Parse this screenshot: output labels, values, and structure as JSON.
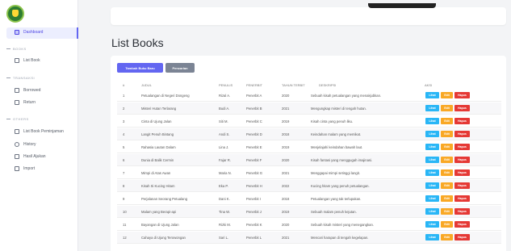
{
  "sidebar": {
    "dashboard": "Dashboard",
    "sections": [
      {
        "label": "BOOKS",
        "items": [
          "List Book"
        ]
      },
      {
        "label": "TRANSAKSI",
        "items": [
          "Borrowed",
          "Return"
        ]
      },
      {
        "label": "OTHERS",
        "items": [
          "List Book Peminjaman",
          "History",
          "Hasil Ajukan",
          "Import"
        ]
      }
    ]
  },
  "page_title": "List Books",
  "toolbar": {
    "add_label": "Tambah Buku Baru",
    "print_label": "Pencarian"
  },
  "table": {
    "headers": [
      "#",
      "JUDUL",
      "PENULIS",
      "PENERBIT",
      "TAHUN TERBIT",
      "DESKRIPSI",
      "AKSI"
    ],
    "rows": [
      [
        "1",
        "Petualangan di Negeri Dongeng",
        "Rizal A.",
        "Penerbit A",
        "2020",
        "Sebuah kisah petualangan yang menakjubkan."
      ],
      [
        "2",
        "Misteri Hutan Terlarang",
        "Budi A.",
        "Penerbit B",
        "2021",
        "Mengungkap misteri di tengah hutan."
      ],
      [
        "3",
        "Cinta di Ujung Jalan",
        "Siti M.",
        "Penerbit C",
        "2019",
        "Kisah cinta yang penuh liku."
      ],
      [
        "4",
        "Langit Penuh Bintang",
        "Andi S.",
        "Penerbit D",
        "2018",
        "Keindahan malam yang memikat."
      ],
      [
        "5",
        "Rahasia Lautan Dalam",
        "Lina J.",
        "Penerbit E",
        "2019",
        "Menjelajahi keindahan bawah laut."
      ],
      [
        "6",
        "Dunia di Balik Cermin",
        "Fajar R.",
        "Penerbit F",
        "2020",
        "Kisah fantasi yang menggugah imajinasi."
      ],
      [
        "7",
        "Mimpi di Atas Awan",
        "Maria N.",
        "Penerbit G",
        "2021",
        "Menggapai mimpi setinggi langit."
      ],
      [
        "8",
        "Kisah Si Kucing Hitam",
        "Eka P.",
        "Penerbit H",
        "2022",
        "Kucing hitam yang penuh petualangan."
      ],
      [
        "9",
        "Perjalanan Seorang Petualang",
        "Dani K.",
        "Penerbit I",
        "2018",
        "Petualangan yang tak terlupakan."
      ],
      [
        "10",
        "Malam yang Berapi-api",
        "Tina W.",
        "Penerbit J",
        "2019",
        "Sebuah malam penuh kejutan."
      ],
      [
        "11",
        "Bayangan di Ujung Jalan",
        "Rizki M.",
        "Penerbit K",
        "2020",
        "Sebuah kisah misteri yang menegangkan."
      ],
      [
        "12",
        "Cahaya di Ujung Terowongan",
        "Sari L.",
        "Penerbit L",
        "2021",
        "Mencari harapan di tengah kegelapan."
      ]
    ],
    "actions": {
      "view": "Lihat",
      "edit": "Edit",
      "delete": "Hapus"
    }
  },
  "colors": {
    "accent": "#6366f1",
    "view": "#29b6f6",
    "edit": "#f9a825",
    "delete": "#e53935"
  }
}
